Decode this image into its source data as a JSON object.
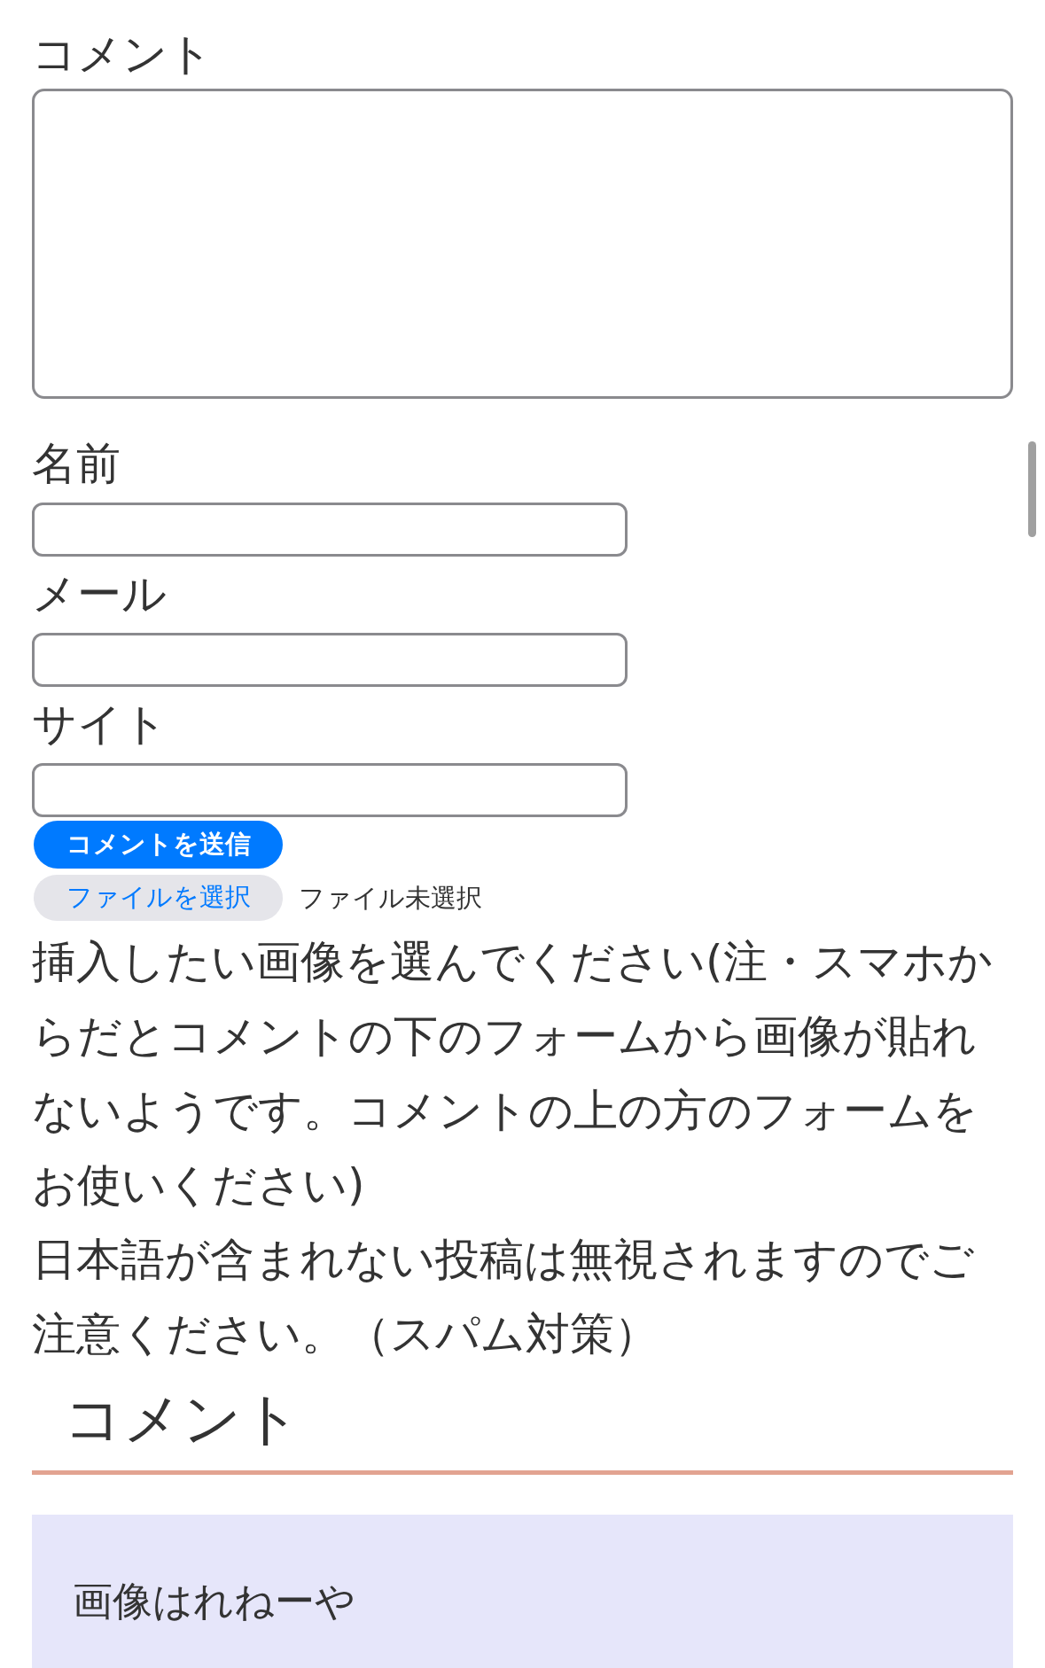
{
  "comment_form": {
    "fields": [
      {
        "kind": "textarea",
        "label": "コメント"
      },
      {
        "kind": "text",
        "label": "名前"
      },
      {
        "kind": "text",
        "label": "メール"
      },
      {
        "kind": "text",
        "label": "サイト"
      }
    ],
    "submit_button": "コメントを送信",
    "file_picker": {
      "button": "ファイルを選択",
      "status": "ファイル未選択"
    },
    "notes": [
      "挿入したい画像を選んでください(注・スマホからだとコメントの下のフォームから画像が貼れないようです。コメントの上の方のフォームをお使いください)",
      "日本語が含まれない投稿は無視されますのでご注意ください。（スパム対策）"
    ]
  },
  "comments_section": {
    "heading": "コメント",
    "comments": [
      {
        "text": "画像はれねーや"
      }
    ]
  }
}
